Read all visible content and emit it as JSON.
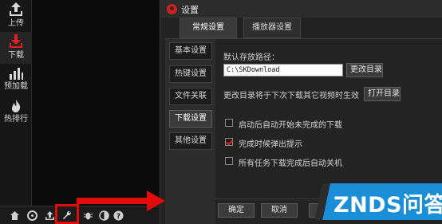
{
  "sidebar": {
    "items": [
      {
        "label": "上传",
        "icon": "upload-icon"
      },
      {
        "label": "下载",
        "icon": "download-icon"
      },
      {
        "label": "预加载",
        "icon": "preload-icon"
      },
      {
        "label": "热排行",
        "icon": "hot-ranking-icon"
      }
    ],
    "active_color": "#e02020"
  },
  "bottom_toolbar": {
    "icons": [
      "home-icon",
      "settings-wheel-icon",
      "upload-tray-icon",
      "wrench-icon",
      "bug-icon",
      "skin-icon",
      "help-icon"
    ],
    "highlighted": "wrench-icon",
    "highlight_color": "#e10b0b"
  },
  "dialog": {
    "title": "设置",
    "tabs": [
      {
        "label": "常规设置",
        "active": true
      },
      {
        "label": "播放器设置",
        "active": false
      }
    ],
    "side_tabs": [
      {
        "label": "基本设置"
      },
      {
        "label": "热键设置"
      },
      {
        "label": "文件关联"
      },
      {
        "label": "下载设置",
        "active": true
      },
      {
        "label": "其他设置"
      }
    ],
    "download": {
      "path_label": "默认存放路径：",
      "path_value": "C:\\SKDownload",
      "change_dir_button": "更改目录",
      "note": "更改目录将于下次下载其它视频时生效",
      "open_dir_button": "打开目录",
      "options": [
        {
          "label": "启动后自动开始未完成的下载",
          "checked": false
        },
        {
          "label": "完成时候弹出提示",
          "checked": true
        },
        {
          "label": "所有任务下载完成后自动关机",
          "checked": false
        }
      ]
    },
    "footer": {
      "ok": "确定",
      "cancel": "取消",
      "apply": "应用"
    }
  },
  "watermark": {
    "text": "ZNDS问答",
    "color": "#1a8fd8"
  }
}
